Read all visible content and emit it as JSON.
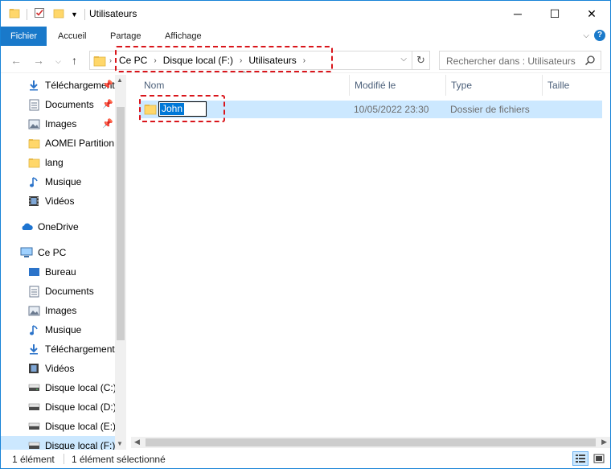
{
  "window": {
    "title": "Utilisateurs",
    "minimize_glyph": "─",
    "maximize_glyph": "☐",
    "close_glyph": "✕"
  },
  "ribbon": {
    "tabs": [
      {
        "label": "Fichier",
        "active": true
      },
      {
        "label": "Accueil",
        "active": false
      },
      {
        "label": "Partage",
        "active": false
      },
      {
        "label": "Affichage",
        "active": false
      }
    ],
    "help_label": "?"
  },
  "address": {
    "crumbs": [
      "Ce PC",
      "Disque local (F:)",
      "Utilisateurs"
    ],
    "separator": "›",
    "dropdown": "⌵",
    "refresh": "↻"
  },
  "search": {
    "placeholder": "Rechercher dans : Utilisateurs"
  },
  "sidebar": {
    "quick_access": [
      {
        "label": "Téléchargements",
        "icon": "download-icon",
        "pinned": true
      },
      {
        "label": "Documents",
        "icon": "document-icon",
        "pinned": true
      },
      {
        "label": "Images",
        "icon": "image-icon",
        "pinned": true
      },
      {
        "label": "AOMEI Partition",
        "icon": "folder-icon",
        "pinned": false
      },
      {
        "label": "lang",
        "icon": "folder-icon",
        "pinned": false
      },
      {
        "label": "Musique",
        "icon": "music-icon",
        "pinned": false
      },
      {
        "label": "Vidéos",
        "icon": "video-icon",
        "pinned": false
      }
    ],
    "onedrive": {
      "label": "OneDrive",
      "icon": "cloud-icon"
    },
    "this_pc": {
      "label": "Ce PC",
      "icon": "computer-icon"
    },
    "pc_items": [
      {
        "label": "Bureau",
        "icon": "desktop-icon"
      },
      {
        "label": "Documents",
        "icon": "document-icon"
      },
      {
        "label": "Images",
        "icon": "image-icon"
      },
      {
        "label": "Musique",
        "icon": "music-icon"
      },
      {
        "label": "Téléchargements",
        "icon": "download-icon"
      },
      {
        "label": "Vidéos",
        "icon": "video-icon"
      },
      {
        "label": "Disque local (C:)",
        "icon": "drive-icon"
      },
      {
        "label": "Disque local (D:)",
        "icon": "drive-icon"
      },
      {
        "label": "Disque local (E:)",
        "icon": "drive-icon"
      },
      {
        "label": "Disque local (F:)",
        "icon": "drive-icon",
        "selected": true
      }
    ]
  },
  "columns": {
    "name": "Nom",
    "modified": "Modifié le",
    "type": "Type",
    "size": "Taille"
  },
  "files": [
    {
      "name": "John",
      "modified": "10/05/2022 23:30",
      "type": "Dossier de fichiers",
      "size": "",
      "renaming": true
    }
  ],
  "status": {
    "count": "1 élément",
    "selected": "1 élément sélectionné"
  },
  "colors": {
    "accent": "#1979ca",
    "selection": "#cce8ff",
    "highlight_border": "#d9151b",
    "folder": "#ffd76a"
  }
}
